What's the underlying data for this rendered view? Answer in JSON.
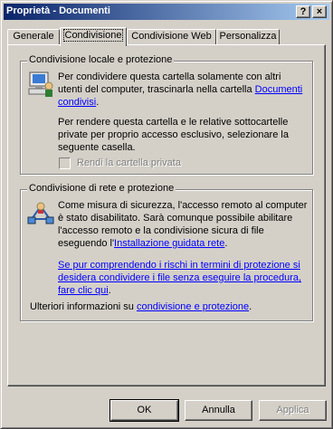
{
  "window": {
    "title": "Proprietà - Documenti",
    "help_label": "?",
    "close_label": "×"
  },
  "tabs": [
    {
      "label": "Generale",
      "active": false
    },
    {
      "label": "Condivisione",
      "active": true
    },
    {
      "label": "Condivisione Web",
      "active": false
    },
    {
      "label": "Personalizza",
      "active": false
    }
  ],
  "local_group": {
    "legend": "Condivisione locale e protezione",
    "para1_line1": "Per condividere questa cartella solamente con altri",
    "para1_line2": "utenti del computer, trascinarla nella cartella ",
    "para1_link_a": "Documenti",
    "para1_link_b": "condivisi",
    "para1_end": ".",
    "para2_line1": "Per rendere questa cartella e le relative sottocartelle",
    "para2_line2": "private per proprio accesso esclusivo, selezionare la",
    "para2_line3": "seguente casella.",
    "checkbox_label": "Rendi la cartella privata"
  },
  "network_group": {
    "legend": "Condivisione di rete e protezione",
    "line1": "Come misura di sicurezza, l'accesso remoto al computer",
    "line2": "è stato disabilitato. Sarà comunque possibile abilitare",
    "line3": "l'accesso remoto e la condivisione sicura di file",
    "line4_prefix": "eseguendo l'",
    "line4_link": "Installazione guidata rete",
    "line4_suffix": ".",
    "link2_line1": "Se pur comprendendo i rischi in termini di protezione si",
    "link2_line2": "desidera condividere i file senza eseguire la procedura,",
    "link2_line3": "fare clic qui",
    "link2_end": "."
  },
  "footer_info": {
    "prefix": "Ulteriori informazioni su ",
    "link": "condivisione e protezione",
    "suffix": "."
  },
  "buttons": {
    "ok": "OK",
    "cancel": "Annulla",
    "apply": "Applica"
  }
}
